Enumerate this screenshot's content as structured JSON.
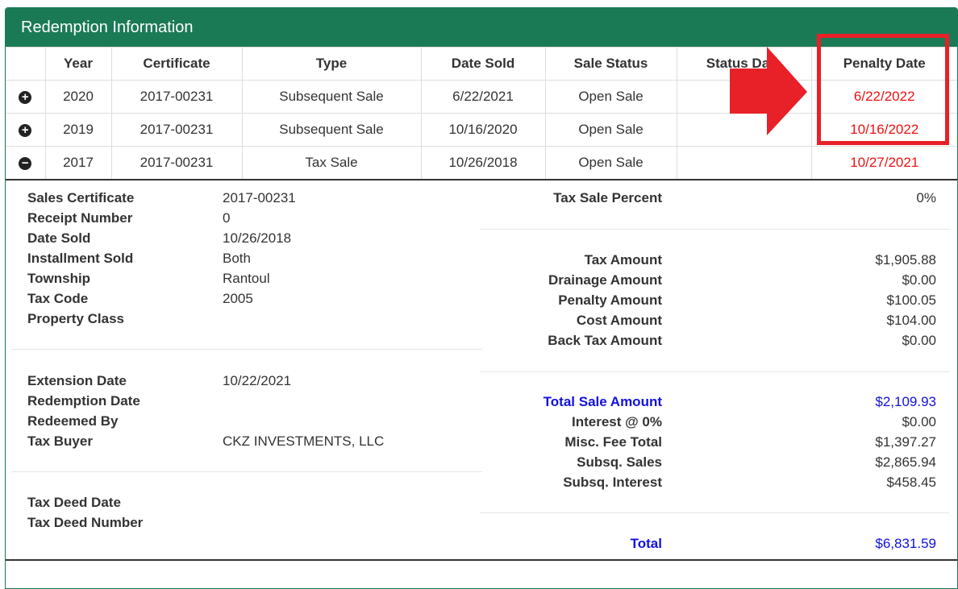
{
  "panel": {
    "title": "Redemption Information"
  },
  "table": {
    "headers": [
      "",
      "Year",
      "Certificate",
      "Type",
      "Date Sold",
      "Sale Status",
      "Status Date",
      "Penalty Date"
    ],
    "rows": [
      {
        "toggle": "+",
        "year": "2020",
        "certificate": "2017-00231",
        "type": "Subsequent Sale",
        "date_sold": "6/22/2021",
        "sale_status": "Open Sale",
        "status_date": "",
        "penalty_date": "6/22/2022"
      },
      {
        "toggle": "+",
        "year": "2019",
        "certificate": "2017-00231",
        "type": "Subsequent Sale",
        "date_sold": "10/16/2020",
        "sale_status": "Open Sale",
        "status_date": "",
        "penalty_date": "10/16/2022"
      },
      {
        "toggle": "−",
        "year": "2017",
        "certificate": "2017-00231",
        "type": "Tax Sale",
        "date_sold": "10/26/2018",
        "sale_status": "Open Sale",
        "status_date": "",
        "penalty_date": "10/27/2021"
      }
    ]
  },
  "detail": {
    "left": {
      "sales_certificate_label": "Sales Certificate",
      "sales_certificate": "2017-00231",
      "receipt_number_label": "Receipt Number",
      "receipt_number": "0",
      "date_sold_label": "Date Sold",
      "date_sold": "10/26/2018",
      "installment_sold_label": "Installment Sold",
      "installment_sold": "Both",
      "township_label": "Township",
      "township": "Rantoul",
      "tax_code_label": "Tax Code",
      "tax_code": "2005",
      "property_class_label": "Property Class",
      "property_class": "",
      "extension_date_label": "Extension Date",
      "extension_date": "10/22/2021",
      "redemption_date_label": "Redemption Date",
      "redemption_date": "",
      "redeemed_by_label": "Redeemed By",
      "redeemed_by": "",
      "tax_buyer_label": "Tax Buyer",
      "tax_buyer": "CKZ INVESTMENTS, LLC",
      "tax_deed_date_label": "Tax Deed Date",
      "tax_deed_date": "",
      "tax_deed_number_label": "Tax Deed Number",
      "tax_deed_number": ""
    },
    "right": {
      "tax_sale_percent_label": "Tax Sale Percent",
      "tax_sale_percent": "0%",
      "tax_amount_label": "Tax Amount",
      "tax_amount": "$1,905.88",
      "drainage_amount_label": "Drainage Amount",
      "drainage_amount": "$0.00",
      "penalty_amount_label": "Penalty Amount",
      "penalty_amount": "$100.05",
      "cost_amount_label": "Cost Amount",
      "cost_amount": "$104.00",
      "back_tax_amount_label": "Back Tax Amount",
      "back_tax_amount": "$0.00",
      "total_sale_amount_label": "Total Sale Amount",
      "total_sale_amount": "$2,109.93",
      "interest_label": "Interest @ 0%",
      "interest": "$0.00",
      "misc_fee_total_label": "Misc. Fee Total",
      "misc_fee_total": "$1,397.27",
      "subsq_sales_label": "Subsq. Sales",
      "subsq_sales": "$2,865.94",
      "subsq_interest_label": "Subsq. Interest",
      "subsq_interest": "$458.45",
      "total_label": "Total",
      "total": "$6,831.59"
    }
  },
  "annotation": {
    "highlight_color": "#e82028",
    "arrow_color": "#e82028"
  },
  "colors": {
    "header_green": "#1b7a56",
    "accent_red": "#ee1111",
    "accent_blue": "#1111dd"
  }
}
